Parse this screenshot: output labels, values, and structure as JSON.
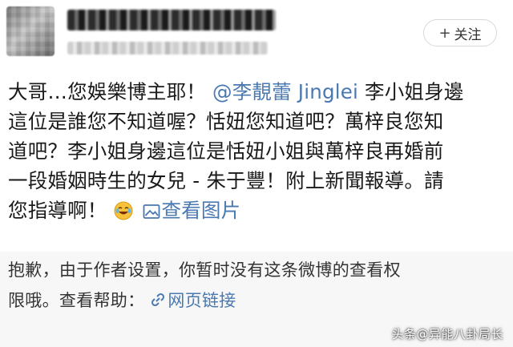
{
  "header": {
    "follow_plus": "+",
    "follow_label": "关注"
  },
  "post": {
    "line1_before_mention": "大哥…您娛樂博主耶！",
    "mention": "@李靚蕾 Jinglei",
    "line1_after_mention": "李小姐身邊",
    "line2": "這位是誰您不知道喔？恬妞您知道吧？萬梓良您知",
    "line3": "道吧？李小姐身邊這位是恬妞小姐與萬梓良再婚前",
    "line4": "一段婚姻時生的女兒 - 朱于豐！附上新聞報導。請",
    "line5_text": "您指導啊！",
    "emoji_icon": "laugh-cry-emoji-icon",
    "image_link_label": "查看图片",
    "image_icon": "image-icon"
  },
  "notice": {
    "line1": "抱歉，由于作者设置，你暂时没有这条微博的查看权",
    "line2_text": "限哦。查看帮助：",
    "link_icon": "link-icon",
    "link_label": "网页链接"
  },
  "watermark": {
    "text": "头条@异能八卦局长"
  },
  "colors": {
    "link": "#4a78b0",
    "text": "#1a1a1a",
    "notice_bg": "#f7f7f7",
    "card_bg": "#ffffff"
  }
}
